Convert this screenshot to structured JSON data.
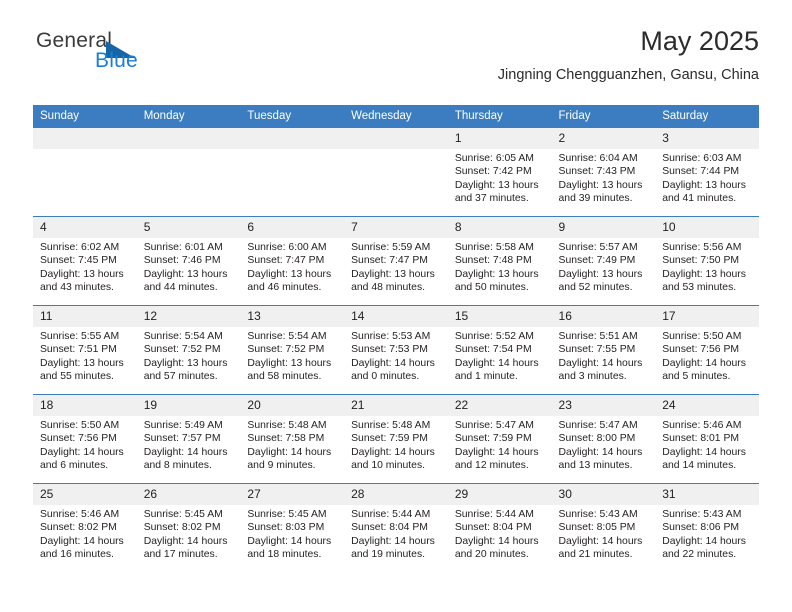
{
  "brand": {
    "word1": "General",
    "word2": "Blue",
    "triangle_color": "#1565a8",
    "blue_color": "#1b7fd4"
  },
  "header": {
    "title": "May 2025",
    "subtitle": "Jingning Chengguanzhen, Gansu, China"
  },
  "theme": {
    "header_blue": "#3b7dc0",
    "daynum_band": "#f0f0f0",
    "text": "#231f20"
  },
  "weekday_headers": [
    "Sunday",
    "Monday",
    "Tuesday",
    "Wednesday",
    "Thursday",
    "Friday",
    "Saturday"
  ],
  "labels": {
    "sunrise": "Sunrise:",
    "sunset": "Sunset:",
    "daylight": "Daylight:"
  },
  "weeks": [
    [
      {
        "day": "",
        "empty": true
      },
      {
        "day": "",
        "empty": true
      },
      {
        "day": "",
        "empty": true
      },
      {
        "day": "",
        "empty": true
      },
      {
        "day": "1",
        "sunrise": "Sunrise: 6:05 AM",
        "sunset": "Sunset: 7:42 PM",
        "daylight": "Daylight: 13 hours and 37 minutes."
      },
      {
        "day": "2",
        "sunrise": "Sunrise: 6:04 AM",
        "sunset": "Sunset: 7:43 PM",
        "daylight": "Daylight: 13 hours and 39 minutes."
      },
      {
        "day": "3",
        "sunrise": "Sunrise: 6:03 AM",
        "sunset": "Sunset: 7:44 PM",
        "daylight": "Daylight: 13 hours and 41 minutes."
      }
    ],
    [
      {
        "day": "4",
        "sunrise": "Sunrise: 6:02 AM",
        "sunset": "Sunset: 7:45 PM",
        "daylight": "Daylight: 13 hours and 43 minutes."
      },
      {
        "day": "5",
        "sunrise": "Sunrise: 6:01 AM",
        "sunset": "Sunset: 7:46 PM",
        "daylight": "Daylight: 13 hours and 44 minutes."
      },
      {
        "day": "6",
        "sunrise": "Sunrise: 6:00 AM",
        "sunset": "Sunset: 7:47 PM",
        "daylight": "Daylight: 13 hours and 46 minutes."
      },
      {
        "day": "7",
        "sunrise": "Sunrise: 5:59 AM",
        "sunset": "Sunset: 7:47 PM",
        "daylight": "Daylight: 13 hours and 48 minutes."
      },
      {
        "day": "8",
        "sunrise": "Sunrise: 5:58 AM",
        "sunset": "Sunset: 7:48 PM",
        "daylight": "Daylight: 13 hours and 50 minutes."
      },
      {
        "day": "9",
        "sunrise": "Sunrise: 5:57 AM",
        "sunset": "Sunset: 7:49 PM",
        "daylight": "Daylight: 13 hours and 52 minutes."
      },
      {
        "day": "10",
        "sunrise": "Sunrise: 5:56 AM",
        "sunset": "Sunset: 7:50 PM",
        "daylight": "Daylight: 13 hours and 53 minutes."
      }
    ],
    [
      {
        "day": "11",
        "sunrise": "Sunrise: 5:55 AM",
        "sunset": "Sunset: 7:51 PM",
        "daylight": "Daylight: 13 hours and 55 minutes."
      },
      {
        "day": "12",
        "sunrise": "Sunrise: 5:54 AM",
        "sunset": "Sunset: 7:52 PM",
        "daylight": "Daylight: 13 hours and 57 minutes."
      },
      {
        "day": "13",
        "sunrise": "Sunrise: 5:54 AM",
        "sunset": "Sunset: 7:52 PM",
        "daylight": "Daylight: 13 hours and 58 minutes."
      },
      {
        "day": "14",
        "sunrise": "Sunrise: 5:53 AM",
        "sunset": "Sunset: 7:53 PM",
        "daylight": "Daylight: 14 hours and 0 minutes."
      },
      {
        "day": "15",
        "sunrise": "Sunrise: 5:52 AM",
        "sunset": "Sunset: 7:54 PM",
        "daylight": "Daylight: 14 hours and 1 minute."
      },
      {
        "day": "16",
        "sunrise": "Sunrise: 5:51 AM",
        "sunset": "Sunset: 7:55 PM",
        "daylight": "Daylight: 14 hours and 3 minutes."
      },
      {
        "day": "17",
        "sunrise": "Sunrise: 5:50 AM",
        "sunset": "Sunset: 7:56 PM",
        "daylight": "Daylight: 14 hours and 5 minutes."
      }
    ],
    [
      {
        "day": "18",
        "sunrise": "Sunrise: 5:50 AM",
        "sunset": "Sunset: 7:56 PM",
        "daylight": "Daylight: 14 hours and 6 minutes."
      },
      {
        "day": "19",
        "sunrise": "Sunrise: 5:49 AM",
        "sunset": "Sunset: 7:57 PM",
        "daylight": "Daylight: 14 hours and 8 minutes."
      },
      {
        "day": "20",
        "sunrise": "Sunrise: 5:48 AM",
        "sunset": "Sunset: 7:58 PM",
        "daylight": "Daylight: 14 hours and 9 minutes."
      },
      {
        "day": "21",
        "sunrise": "Sunrise: 5:48 AM",
        "sunset": "Sunset: 7:59 PM",
        "daylight": "Daylight: 14 hours and 10 minutes."
      },
      {
        "day": "22",
        "sunrise": "Sunrise: 5:47 AM",
        "sunset": "Sunset: 7:59 PM",
        "daylight": "Daylight: 14 hours and 12 minutes."
      },
      {
        "day": "23",
        "sunrise": "Sunrise: 5:47 AM",
        "sunset": "Sunset: 8:00 PM",
        "daylight": "Daylight: 14 hours and 13 minutes."
      },
      {
        "day": "24",
        "sunrise": "Sunrise: 5:46 AM",
        "sunset": "Sunset: 8:01 PM",
        "daylight": "Daylight: 14 hours and 14 minutes."
      }
    ],
    [
      {
        "day": "25",
        "sunrise": "Sunrise: 5:46 AM",
        "sunset": "Sunset: 8:02 PM",
        "daylight": "Daylight: 14 hours and 16 minutes."
      },
      {
        "day": "26",
        "sunrise": "Sunrise: 5:45 AM",
        "sunset": "Sunset: 8:02 PM",
        "daylight": "Daylight: 14 hours and 17 minutes."
      },
      {
        "day": "27",
        "sunrise": "Sunrise: 5:45 AM",
        "sunset": "Sunset: 8:03 PM",
        "daylight": "Daylight: 14 hours and 18 minutes."
      },
      {
        "day": "28",
        "sunrise": "Sunrise: 5:44 AM",
        "sunset": "Sunset: 8:04 PM",
        "daylight": "Daylight: 14 hours and 19 minutes."
      },
      {
        "day": "29",
        "sunrise": "Sunrise: 5:44 AM",
        "sunset": "Sunset: 8:04 PM",
        "daylight": "Daylight: 14 hours and 20 minutes."
      },
      {
        "day": "30",
        "sunrise": "Sunrise: 5:43 AM",
        "sunset": "Sunset: 8:05 PM",
        "daylight": "Daylight: 14 hours and 21 minutes."
      },
      {
        "day": "31",
        "sunrise": "Sunrise: 5:43 AM",
        "sunset": "Sunset: 8:06 PM",
        "daylight": "Daylight: 14 hours and 22 minutes."
      }
    ]
  ]
}
